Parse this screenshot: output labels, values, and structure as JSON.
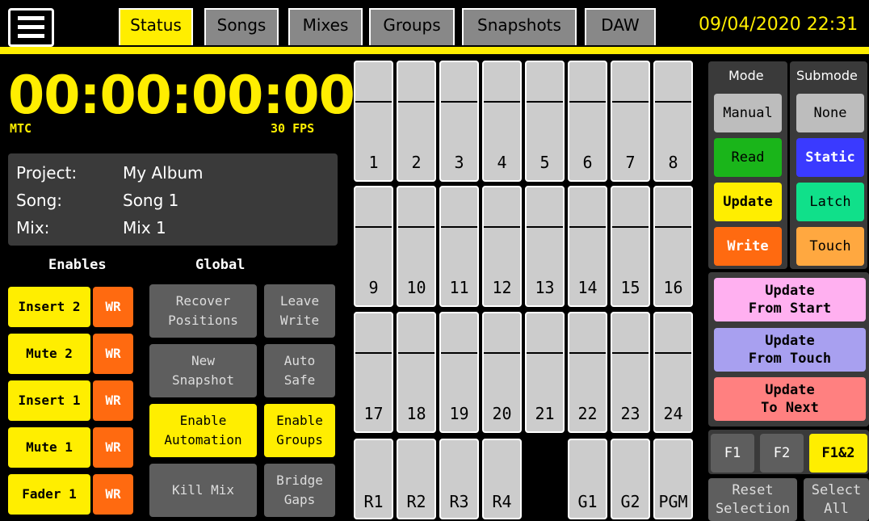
{
  "tabs": [
    "Status",
    "Songs",
    "Mixes",
    "Groups",
    "Snapshots",
    "DAW"
  ],
  "datetime": "09/04/2020 22:31",
  "timecode": {
    "value": "00:00:00:00",
    "source": "MTC",
    "fps": "30 FPS"
  },
  "info": {
    "project_label": "Project:",
    "project": "My Album",
    "song_label": "Song:",
    "song": "Song 1",
    "mix_label": "Mix:",
    "mix": "Mix 1"
  },
  "enables": {
    "header": "Enables",
    "items": [
      {
        "label": "Insert 2",
        "wr": "WR"
      },
      {
        "label": "Mute 2",
        "wr": "WR"
      },
      {
        "label": "Insert 1",
        "wr": "WR"
      },
      {
        "label": "Mute 1",
        "wr": "WR"
      },
      {
        "label": "Fader 1",
        "wr": "WR"
      }
    ]
  },
  "global": {
    "header": "Global",
    "recover": "Recover\nPositions",
    "leave_write": "Leave\nWrite",
    "new_snapshot": "New\nSnapshot",
    "auto_safe": "Auto\nSafe",
    "enable_automation": "Enable\nAutomation",
    "enable_groups": "Enable\nGroups",
    "kill_mix": "Kill Mix",
    "bridge_gaps": "Bridge\nGaps"
  },
  "channels": {
    "row1": [
      "1",
      "2",
      "3",
      "4",
      "5",
      "6",
      "7",
      "8"
    ],
    "row2": [
      "9",
      "10",
      "11",
      "12",
      "13",
      "14",
      "15",
      "16"
    ],
    "row3": [
      "17",
      "18",
      "19",
      "20",
      "21",
      "22",
      "23",
      "24"
    ],
    "row4": [
      "R1",
      "R2",
      "R3",
      "R4",
      "",
      "G1",
      "G2",
      "PGM"
    ]
  },
  "mode": {
    "header": "Mode",
    "items": [
      "Manual",
      "Read",
      "Update",
      "Write"
    ],
    "colors": [
      "#bdbdbd",
      "#1ab51a",
      "#ffee00",
      "#ff6a10"
    ]
  },
  "submode": {
    "header": "Submode",
    "items": [
      "None",
      "Static",
      "Latch",
      "Touch"
    ],
    "colors": [
      "#bdbdbd",
      "#3a3aff",
      "#10e08a",
      "#ffa840"
    ]
  },
  "update_buttons": [
    {
      "label": "Update\nFrom Start",
      "color": "#ffb0f0"
    },
    {
      "label": "Update\nFrom Touch",
      "color": "#a8a0f0"
    },
    {
      "label": "Update\nTo Next",
      "color": "#ff8080"
    }
  ],
  "fkeys": [
    "F1",
    "F2",
    "F1&2"
  ],
  "reset_selection": "Reset\nSelection",
  "select_all": "Select\nAll"
}
